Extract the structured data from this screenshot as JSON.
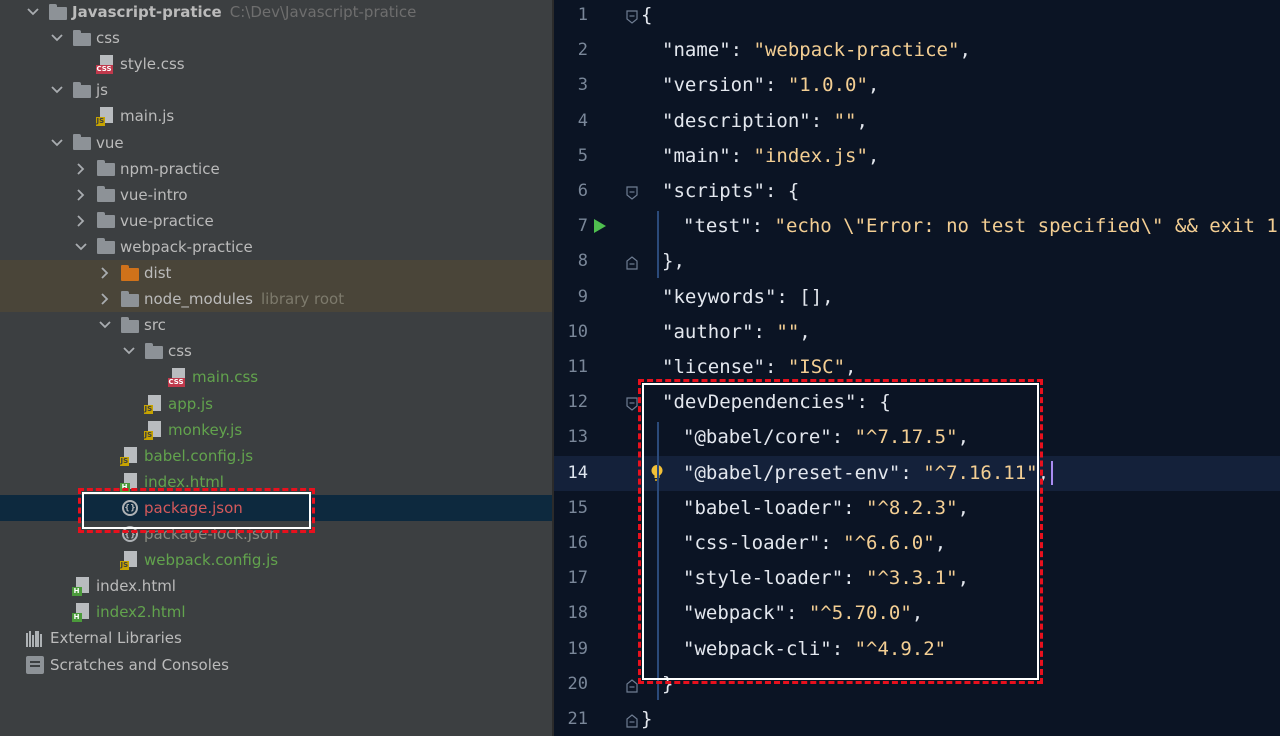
{
  "tree": {
    "rows": [
      {
        "label": "Javascript-pratice",
        "sub": "C:\\Dev\\Javascript-pratice",
        "depth": 0,
        "chevron": "down",
        "icon": "folder",
        "style": "bold"
      },
      {
        "label": "css",
        "depth": 1,
        "chevron": "down",
        "icon": "folder"
      },
      {
        "label": "style.css",
        "depth": 2,
        "chevron": "none",
        "icon": "css"
      },
      {
        "label": "js",
        "depth": 1,
        "chevron": "down",
        "icon": "folder"
      },
      {
        "label": "main.js",
        "depth": 2,
        "chevron": "none",
        "icon": "js"
      },
      {
        "label": "vue",
        "depth": 1,
        "chevron": "down",
        "icon": "folder"
      },
      {
        "label": "npm-practice",
        "depth": 2,
        "chevron": "right",
        "icon": "folder"
      },
      {
        "label": "vue-intro",
        "depth": 2,
        "chevron": "right",
        "icon": "folder"
      },
      {
        "label": "vue-practice",
        "depth": 2,
        "chevron": "right",
        "icon": "folder"
      },
      {
        "label": "webpack-practice",
        "depth": 2,
        "chevron": "down",
        "icon": "folder"
      },
      {
        "label": "dist",
        "depth": 3,
        "chevron": "right",
        "icon": "folder-orange",
        "row": "lib"
      },
      {
        "label": "node_modules",
        "sub": "library root",
        "depth": 3,
        "chevron": "right",
        "icon": "folder",
        "row": "lib"
      },
      {
        "label": "src",
        "depth": 3,
        "chevron": "down",
        "icon": "folder"
      },
      {
        "label": "css",
        "depth": 4,
        "chevron": "down",
        "icon": "folder"
      },
      {
        "label": "main.css",
        "depth": 5,
        "chevron": "none",
        "icon": "css",
        "style": "green"
      },
      {
        "label": "app.js",
        "depth": 4,
        "chevron": "none",
        "icon": "js",
        "style": "green"
      },
      {
        "label": "monkey.js",
        "depth": 4,
        "chevron": "none",
        "icon": "js",
        "style": "green"
      },
      {
        "label": "babel.config.js",
        "depth": 3,
        "chevron": "none",
        "icon": "js",
        "style": "green"
      },
      {
        "label": "index.html",
        "depth": 3,
        "chevron": "none",
        "icon": "html",
        "style": "green"
      },
      {
        "label": "package.json",
        "depth": 3,
        "chevron": "none",
        "icon": "json",
        "style": "red",
        "row": "sel"
      },
      {
        "label": "package-lock.json",
        "depth": 3,
        "chevron": "none",
        "icon": "json",
        "style": "faded"
      },
      {
        "label": "webpack.config.js",
        "depth": 3,
        "chevron": "none",
        "icon": "js",
        "style": "green"
      },
      {
        "label": "index.html",
        "depth": 1,
        "chevron": "none",
        "icon": "html"
      },
      {
        "label": "index2.html",
        "depth": 1,
        "chevron": "none",
        "icon": "html",
        "style": "green"
      },
      {
        "label": "External Libraries",
        "depth": 0,
        "chevron": "none",
        "icon": "ext"
      },
      {
        "label": "Scratches and Consoles",
        "depth": 0,
        "chevron": "none",
        "icon": "scratch"
      }
    ]
  },
  "editor": {
    "current_line": "14",
    "lines": [
      {
        "n": "1",
        "indent": 0,
        "parts": [
          [
            "p",
            "{"
          ]
        ],
        "fold": "open"
      },
      {
        "n": "2",
        "indent": 1,
        "parts": [
          [
            "k",
            "\"name\""
          ],
          [
            "p",
            ": "
          ],
          [
            "v",
            "\"webpack-practice\""
          ],
          [
            "p",
            ","
          ]
        ]
      },
      {
        "n": "3",
        "indent": 1,
        "parts": [
          [
            "k",
            "\"version\""
          ],
          [
            "p",
            ": "
          ],
          [
            "v",
            "\"1.0.0\""
          ],
          [
            "p",
            ","
          ]
        ]
      },
      {
        "n": "4",
        "indent": 1,
        "parts": [
          [
            "k",
            "\"description\""
          ],
          [
            "p",
            ": "
          ],
          [
            "v",
            "\"\""
          ],
          [
            "p",
            ","
          ]
        ]
      },
      {
        "n": "5",
        "indent": 1,
        "parts": [
          [
            "k",
            "\"main\""
          ],
          [
            "p",
            ": "
          ],
          [
            "v",
            "\"index.js\""
          ],
          [
            "p",
            ","
          ]
        ]
      },
      {
        "n": "6",
        "indent": 1,
        "parts": [
          [
            "k",
            "\"scripts\""
          ],
          [
            "p",
            ": {"
          ]
        ],
        "fold": "open"
      },
      {
        "n": "7",
        "indent": 2,
        "parts": [
          [
            "k",
            "\"test\""
          ],
          [
            "p",
            ": "
          ],
          [
            "v",
            "\"echo \\\"Error: no test specified\\\" && exit 1\""
          ]
        ],
        "run": true
      },
      {
        "n": "8",
        "indent": 1,
        "parts": [
          [
            "p",
            "},"
          ]
        ],
        "fold": "close"
      },
      {
        "n": "9",
        "indent": 1,
        "parts": [
          [
            "k",
            "\"keywords\""
          ],
          [
            "p",
            ": [],"
          ]
        ]
      },
      {
        "n": "10",
        "indent": 1,
        "parts": [
          [
            "k",
            "\"author\""
          ],
          [
            "p",
            ": "
          ],
          [
            "v",
            "\"\""
          ],
          [
            "p",
            ","
          ]
        ]
      },
      {
        "n": "11",
        "indent": 1,
        "parts": [
          [
            "k",
            "\"license\""
          ],
          [
            "p",
            ": "
          ],
          [
            "v",
            "\"ISC\""
          ],
          [
            "p",
            ","
          ]
        ]
      },
      {
        "n": "12",
        "indent": 1,
        "parts": [
          [
            "k",
            "\"devDependencies\""
          ],
          [
            "p",
            ": {"
          ]
        ],
        "fold": "open"
      },
      {
        "n": "13",
        "indent": 2,
        "parts": [
          [
            "k",
            "\"@babel/core\""
          ],
          [
            "p",
            ": "
          ],
          [
            "v",
            "\"^7.17.5\""
          ],
          [
            "p",
            ","
          ]
        ]
      },
      {
        "n": "14",
        "indent": 2,
        "parts": [
          [
            "k",
            "\"@babel/preset-env\""
          ],
          [
            "p",
            ": "
          ],
          [
            "v",
            "\"^7.16.11\""
          ],
          [
            "p",
            ","
          ]
        ],
        "bulb": true,
        "caret": true
      },
      {
        "n": "15",
        "indent": 2,
        "parts": [
          [
            "k",
            "\"babel-loader\""
          ],
          [
            "p",
            ": "
          ],
          [
            "v",
            "\"^8.2.3\""
          ],
          [
            "p",
            ","
          ]
        ]
      },
      {
        "n": "16",
        "indent": 2,
        "parts": [
          [
            "k",
            "\"css-loader\""
          ],
          [
            "p",
            ": "
          ],
          [
            "v",
            "\"^6.6.0\""
          ],
          [
            "p",
            ","
          ]
        ]
      },
      {
        "n": "17",
        "indent": 2,
        "parts": [
          [
            "k",
            "\"style-loader\""
          ],
          [
            "p",
            ": "
          ],
          [
            "v",
            "\"^3.3.1\""
          ],
          [
            "p",
            ","
          ]
        ]
      },
      {
        "n": "18",
        "indent": 2,
        "parts": [
          [
            "k",
            "\"webpack\""
          ],
          [
            "p",
            ": "
          ],
          [
            "v",
            "\"^5.70.0\""
          ],
          [
            "p",
            ","
          ]
        ]
      },
      {
        "n": "19",
        "indent": 2,
        "parts": [
          [
            "k",
            "\"webpack-cli\""
          ],
          [
            "p",
            ": "
          ],
          [
            "v",
            "\"^4.9.2\""
          ]
        ]
      },
      {
        "n": "20",
        "indent": 1,
        "parts": [
          [
            "p",
            "}"
          ]
        ],
        "fold": "close"
      },
      {
        "n": "21",
        "indent": 0,
        "parts": [
          [
            "p",
            "}"
          ]
        ],
        "fold": "close"
      }
    ]
  },
  "colors": {
    "tree_bg": "#3c3f41",
    "editor_bg": "#0b1424",
    "string_value": "#f3ce93",
    "highlight_border": "#e8101d",
    "selected_row": "#0d293e",
    "library_row": "#4a4539"
  }
}
